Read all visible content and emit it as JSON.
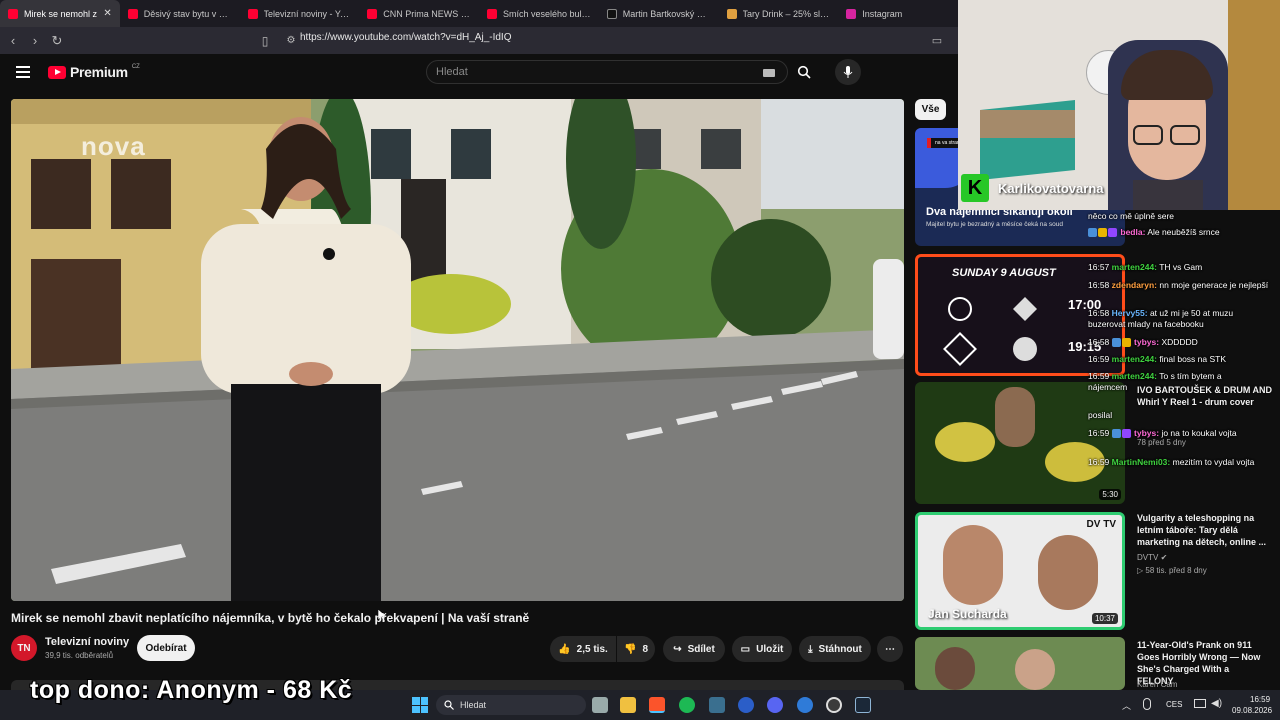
{
  "browser": {
    "tabs": [
      {
        "title": "Mirek se nemohl z",
        "active": true,
        "color": "#ff0033"
      },
      {
        "title": "Děsivý stav bytu v Karviné",
        "color": "#ff0033"
      },
      {
        "title": "Televizní noviny - YouTub",
        "color": "#ff0033"
      },
      {
        "title": "CNN Prima NEWS - YouTu",
        "color": "#ff0033"
      },
      {
        "title": "Smích veselého buldozer",
        "color": "#ff0033"
      },
      {
        "title": "Martin Bartkovský on X: \"",
        "color": "#ffffff"
      },
      {
        "title": "Tary Drink – 25% sleva na",
        "color": "#e0a040"
      },
      {
        "title": "Instagram",
        "color": "#d6249f"
      }
    ],
    "close_glyph": "✕",
    "url": "https://www.youtube.com/watch?v=dH_Aj_-IdIQ"
  },
  "youtube": {
    "logo": "Premium",
    "region": "CZ",
    "search_placeholder": "Hledat",
    "player_watermark": "nova",
    "video_title": "Mirek se nemohl zbavit neplatícího nájemníka, v bytě ho čekalo překvapení | Na vaší straně",
    "channel": {
      "avatar": "TN",
      "name": "Televizní noviny",
      "subs": "39,9 tis. odběratelů",
      "subscribe": "Odebírat"
    },
    "actions": {
      "likes": "2,5 tis.",
      "dislikes": "8",
      "share": "Sdílet",
      "save": "Uložit",
      "download": "Stáhnout"
    },
    "filter_chip": "Vše"
  },
  "sidebar": {
    "items": [
      {
        "overlay": "Dva nájemníci šikanují okolí",
        "sub": "Majitel bytu je bezradný a měsíce čeká na soud",
        "chip": "na va strane"
      },
      {
        "overlay": "SUNDAY 9 AUGUST",
        "score1": "17:00",
        "score2": "19:15"
      },
      {
        "duration": "5:30",
        "title": "IVO BARTOUŠEK & DRUM AND",
        "title2": "Whirl Y Reel 1 -  drum cover",
        "meta": "78 před 5 dny"
      },
      {
        "overlay": "Jan Sucharda",
        "badge": "DV TV",
        "duration": "10:37",
        "title": "Vulgarity a teleshopping na letním táboře: Tary dělá marketing na dětech, online ...",
        "channel": "DVTV",
        "meta": "58 tis.  před 8 dny"
      },
      {
        "title": "11-Year-Old's Prank on 911 Goes Horribly Wrong — Now She's Charged With a FELONY",
        "channel": "Karen Cam"
      }
    ]
  },
  "stream": {
    "streamer_name": "Karlikovatovarna",
    "chat": [
      {
        "user": "",
        "text": "něco co mě úplně sere"
      },
      {
        "time": "16:57",
        "user": "bedla:",
        "text": "Ale neuběžíš srnce"
      },
      {
        "time": "16:57",
        "user": "marten244:",
        "text": "TH vs Gam"
      },
      {
        "time": "16:58",
        "user": "zdendaryn:",
        "text": "nn moje generace je nejlepší"
      },
      {
        "time": "16:58",
        "user": "Hervy55:",
        "text": "at už mi je 50 at muzu buzerovat mlady na facebooku"
      },
      {
        "time": "16:58",
        "user": "tybys:",
        "text": "XDDDDD"
      },
      {
        "time": "16:59",
        "user": "marten244:",
        "text": "final boss na STK"
      },
      {
        "time": "16:59",
        "user": "marten244:",
        "text": "To s tím bytem a nájemcem"
      },
      {
        "time": "",
        "user": "",
        "text": "posilal"
      },
      {
        "time": "16:59",
        "user": "tybys:",
        "text": "jo na to koukal vojta"
      },
      {
        "time": "16:59",
        "user": "MartinNemi03:",
        "text": "mezitím to vydal vojta"
      }
    ],
    "donation": "top dono:  Anonym  - 68 Kč"
  },
  "taskbar": {
    "search": "Hledat",
    "lang": "CES",
    "time": "16:59",
    "date": "09.08.2026"
  }
}
